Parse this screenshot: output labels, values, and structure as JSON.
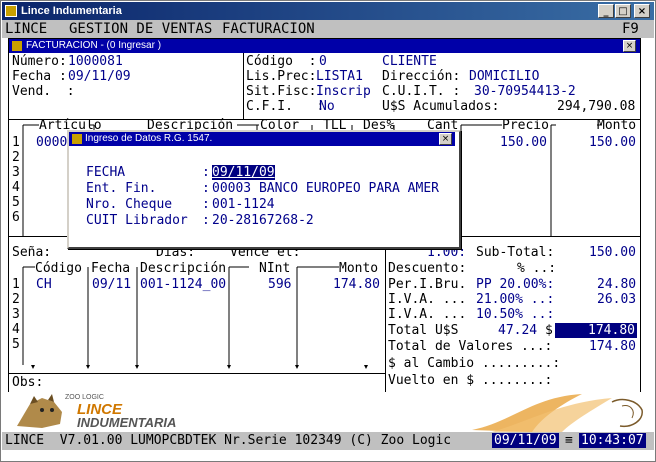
{
  "window": {
    "title": "Lince Indumentaria",
    "shortcut": "F9"
  },
  "menu": [
    "LINCE",
    "GESTION DE VENTAS",
    "FACTURACION"
  ],
  "inner_window": {
    "title": "FACTURACION - (0  Ingresar )"
  },
  "header": {
    "numero_label": "Número:",
    "numero": "1000081",
    "fecha_label": "Fecha :",
    "fecha": "09/11/09",
    "vend_label": "Vend.  :",
    "codigo_label": "Código  :",
    "codigo": "0",
    "cliente": "CLIENTE",
    "lisprec_label": "Lis.Prec:",
    "lisprec": "LISTA1",
    "direccion_label": "Dirección:",
    "direccion": "DOMICILIO",
    "sitfisc_label": "Sit.Fisc:",
    "sitfisc": "Inscrip",
    "cuit_label": "C.U.I.T. :",
    "cuit": "30-70954413-2",
    "cfi_label": "C.F.I.   :",
    "cfi": "No",
    "acumulados_label": "U$S Acumulados:",
    "acumulados": "294,790.08"
  },
  "items_table": {
    "headers": [
      "Artículo",
      "Descripción",
      "Color",
      "TLL",
      "Des%",
      "Cant",
      "Precio",
      "Monto"
    ],
    "rows": [
      "1",
      "2",
      "3",
      "4",
      "5",
      "6"
    ],
    "first_articulo": "0000",
    "precio": "150.00",
    "monto": "150.00"
  },
  "dialog": {
    "title": "Ingreso de Datos R.G. 1547.",
    "fecha_label": "FECHA",
    "fecha": "09/11/09",
    "entfin_label": "Ent. Fin.",
    "entfin": "00003 BANCO EUROPEO PARA AMER",
    "cheque_label": "Nro. Cheque",
    "cheque": "001-1124",
    "cuit_label": "CUIT Librador",
    "cuit": "20-28167268-2"
  },
  "payments": {
    "sena_label": "Seña:",
    "dias_label": "Dias:",
    "vence_label": "Vence el:",
    "headers": [
      "Código",
      "Fecha",
      "Descripción",
      "NInt",
      "Monto"
    ],
    "rows": [
      "1",
      "2",
      "3",
      "4",
      "5"
    ],
    "row1": {
      "codigo": "CH",
      "fecha": "09/11",
      "descripcion": "001-1124_00",
      "nint": "596",
      "monto": "174.80"
    },
    "obs_label": "Obs:"
  },
  "totals": {
    "rate": "1.00:",
    "subtotal_label": "Sub-Total:",
    "subtotal": "150.00",
    "descuento_label": "Descuento:",
    "descuento_pct": "% ..:",
    "perib_label": "Per.I.Bru.",
    "perib_pct": "PP 20.00%:",
    "perib": "24.80",
    "iva1_label": "I.V.A. ...",
    "iva1_pct": "21.00% ..:",
    "iva1": "26.03",
    "iva2_label": "I.V.A. ...",
    "iva2_pct": "10.50% ..:",
    "total_label": "Total U$S",
    "total_mid": "47.24",
    "total_currency": "$",
    "total": "174.80",
    "total_valores_label": "Total de Valores ...:",
    "total_valores": "174.80",
    "cambio_label": "$ al Cambio .........:",
    "vuelto_label": "Vuelto en $ ........:"
  },
  "footer": {
    "brand_small": "ZOO LOGIC",
    "brand_line1": "LINCE",
    "brand_line2": "INDUMENTARIA"
  },
  "status": {
    "text": "LINCE  V7.01.00 LUMOPCBDTEK Nr.Serie 102349 (C) Zoo Logic",
    "date": "09/11/09",
    "sep": "≡",
    "time": "10:43:07"
  }
}
